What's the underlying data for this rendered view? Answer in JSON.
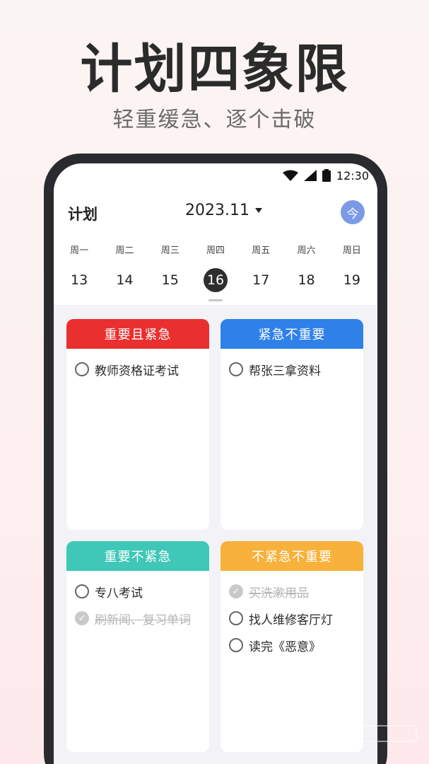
{
  "promo": {
    "headline": "计划四象限",
    "subline": "轻重缓急、逐个击破"
  },
  "statusbar": {
    "time": "12:30"
  },
  "header": {
    "title": "计划",
    "month": "2023.11",
    "today_label": "今"
  },
  "week": [
    {
      "weekday": "周一",
      "date": "13",
      "selected": false
    },
    {
      "weekday": "周二",
      "date": "14",
      "selected": false
    },
    {
      "weekday": "周三",
      "date": "15",
      "selected": false
    },
    {
      "weekday": "周四",
      "date": "16",
      "selected": true
    },
    {
      "weekday": "周五",
      "date": "17",
      "selected": false
    },
    {
      "weekday": "周六",
      "date": "18",
      "selected": false
    },
    {
      "weekday": "周日",
      "date": "19",
      "selected": false
    }
  ],
  "quadrants": [
    {
      "title": "重要且紧急",
      "color": "#ea2f2f",
      "tasks": [
        {
          "text": "教师资格证考试",
          "done": false
        }
      ]
    },
    {
      "title": "紧急不重要",
      "color": "#2f80e8",
      "tasks": [
        {
          "text": "帮张三拿资料",
          "done": false
        }
      ]
    },
    {
      "title": "重要不紧急",
      "color": "#3fc7b8",
      "tasks": [
        {
          "text": "专八考试",
          "done": false
        },
        {
          "text": "刷新闻、复习单词",
          "done": true
        }
      ]
    },
    {
      "title": "不紧急不重要",
      "color": "#f8b13a",
      "tasks": [
        {
          "text": "买洗漱用品",
          "done": true
        },
        {
          "text": "找人维修客厅灯",
          "done": false
        },
        {
          "text": "读完《恶意》",
          "done": false
        }
      ]
    }
  ]
}
